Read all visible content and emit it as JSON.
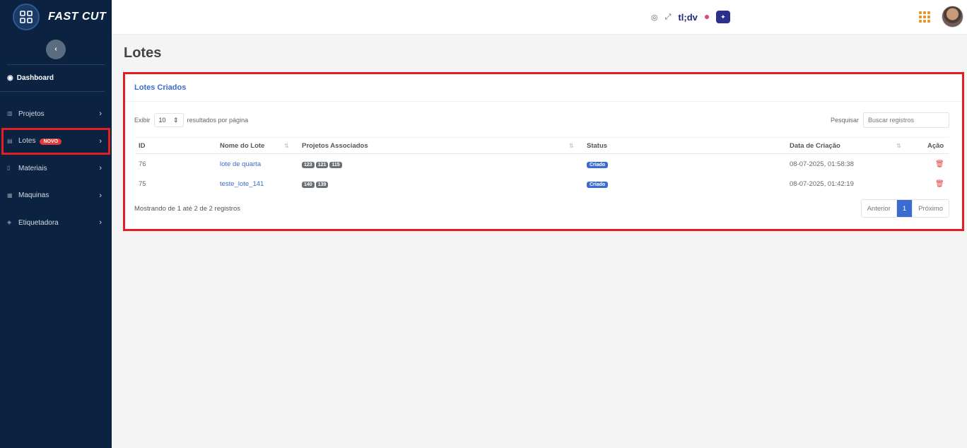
{
  "sidebar": {
    "brand": "FAST CUT",
    "collapse_icon": "chevron-left-icon",
    "dashboard_label": "Dashboard",
    "items": [
      {
        "label": "Projetos",
        "icon": "kanban-icon"
      },
      {
        "label": "Lotes",
        "icon": "layers-icon",
        "badge": "NOVO"
      },
      {
        "label": "Materiais",
        "icon": "box-icon"
      },
      {
        "label": "Maquinas",
        "icon": "machine-icon"
      },
      {
        "label": "Etiquetadora",
        "icon": "tag-icon"
      }
    ]
  },
  "topbar": {
    "tldv_label": "tl;dv",
    "icons": [
      "eye-off-icon",
      "expand-icon",
      "record-dot-icon",
      "tldv-app-icon",
      "apps-grid-icon",
      "avatar"
    ]
  },
  "page": {
    "title": "Lotes"
  },
  "card": {
    "title": "Lotes Criados",
    "show_label": "Exibir",
    "length_value": "10",
    "per_page_label": "resultados por página",
    "search_label": "Pesquisar",
    "search_placeholder": "Buscar registros",
    "columns": [
      "ID",
      "Nome do Lote",
      "Projetos Associados",
      "Status",
      "Data de Criação",
      "Ação"
    ],
    "rows": [
      {
        "id": "76",
        "name": "lote de quarta",
        "projects": [
          "123",
          "121",
          "115"
        ],
        "status": "Criado",
        "date": "08-07-2025, 01:58:38"
      },
      {
        "id": "75",
        "name": "teste_lote_141",
        "projects": [
          "140",
          "139"
        ],
        "status": "Criado",
        "date": "08-07-2025, 01:42:19"
      }
    ],
    "info": "Mostrando de 1 até 2 de 2 registros",
    "pagination": {
      "prev": "Anterior",
      "current": "1",
      "next": "Próximo"
    }
  },
  "colors": {
    "sidebar_bg": "#0b2340",
    "accent": "#3b6ad0",
    "danger": "#e03a3a",
    "highlight": "#e31e24"
  }
}
